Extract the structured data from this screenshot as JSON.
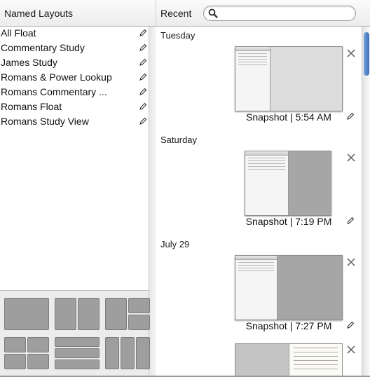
{
  "header": {
    "left_title": "Named Layouts",
    "right_title": "Recent",
    "search": {
      "value": "",
      "placeholder": "",
      "icon": "search-icon"
    }
  },
  "named_layouts": [
    {
      "label": "All Float",
      "icon": "edit-pencil-icon"
    },
    {
      "label": "Commentary Study",
      "icon": "edit-pencil-icon"
    },
    {
      "label": "James Study",
      "icon": "edit-pencil-icon"
    },
    {
      "label": "Romans & Power Lookup",
      "icon": "edit-pencil-icon"
    },
    {
      "label": "Romans Commentary ...",
      "icon": "edit-pencil-icon"
    },
    {
      "label": "Romans Float",
      "icon": "edit-pencil-icon"
    },
    {
      "label": "Romans Study View",
      "icon": "edit-pencil-icon"
    }
  ],
  "layout_templates": [
    "single-pane-template",
    "two-column-template",
    "left-with-right-split-template",
    "grid-split-template",
    "three-row-template",
    "three-column-template"
  ],
  "recent": [
    {
      "day": "Tuesday",
      "caption": "Snapshot | 5:54 AM"
    },
    {
      "day": "Saturday",
      "caption": "Snapshot | 7:19 PM"
    },
    {
      "day": "July 29",
      "caption": "Snapshot | 7:27 PM"
    }
  ],
  "colors": {
    "scroll_thumb": "#4f83c9",
    "template_fill": "#ababab"
  }
}
